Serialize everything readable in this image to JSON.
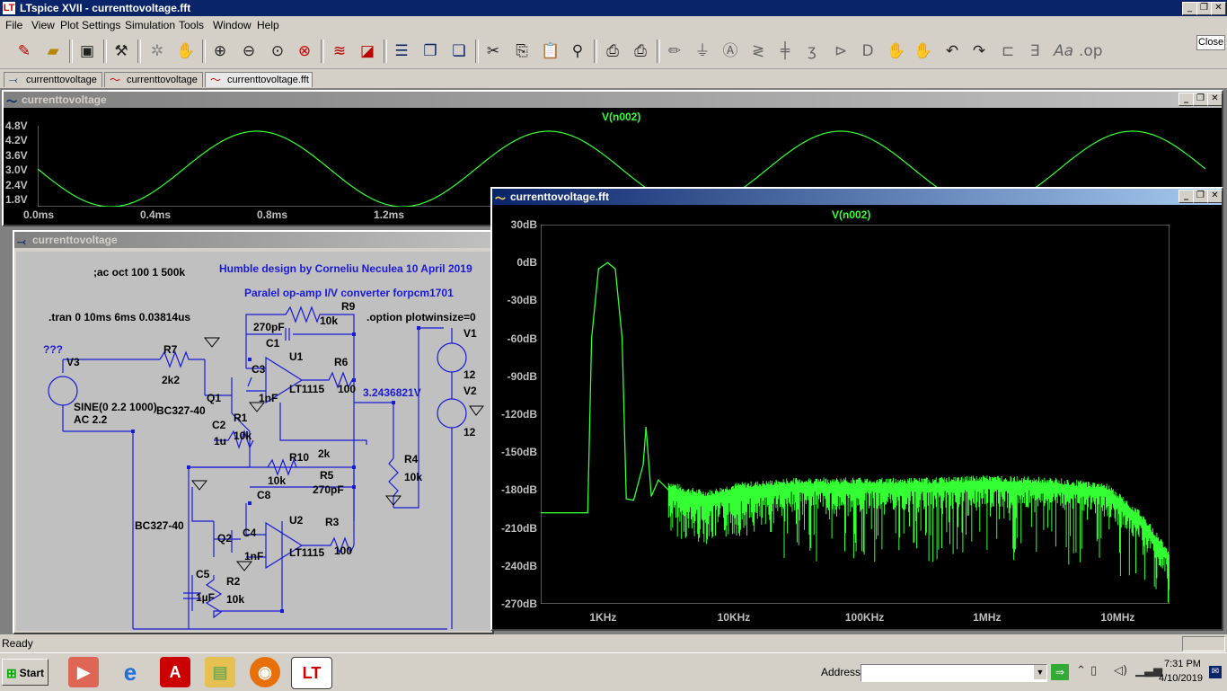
{
  "app": {
    "title": "LTspice XVII - currenttovoltage.fft",
    "icon": "ltspice-icon"
  },
  "window_buttons": [
    "_",
    "❐",
    "✕"
  ],
  "menu": [
    "File",
    "View",
    "Plot Settings",
    "Simulation",
    "Tools",
    "Window",
    "Help"
  ],
  "toolbar": {
    "icons": [
      "new-schematic-icon",
      "open-icon",
      "save-icon",
      "control-panel-icon",
      "run-icon",
      "halt-icon",
      "zoom-in-icon",
      "zoom-out-icon",
      "zoom-fit-icon",
      "zoom-cancel-icon",
      "autorange-icon",
      "pick-visible-icon",
      "tile-horizontal-icon",
      "tile-vertical-icon",
      "cascade-icon",
      "cut-icon",
      "copy-icon",
      "paste-icon",
      "find-icon",
      "print-icon",
      "print-setup-icon",
      "draw-wire-icon",
      "ground-icon",
      "label-net-icon",
      "resistor-icon",
      "capacitor-icon",
      "inductor-icon",
      "diode-icon",
      "component-icon",
      "move-icon",
      "drag-icon",
      "undo-icon",
      "redo-icon",
      "rotate-icon",
      "mirror-icon",
      "text-icon",
      "spice-directive-icon"
    ],
    "close_label": "Close"
  },
  "tabs": [
    {
      "label": "currenttovoltage",
      "icon": "schematic-icon"
    },
    {
      "label": "currenttovoltage",
      "icon": "waveform-icon"
    },
    {
      "label": "currenttovoltage.fft",
      "icon": "waveform-icon"
    }
  ],
  "time_plot": {
    "title": "currenttovoltage",
    "trace": "V(n002)",
    "trace_color": "#33ff33",
    "y_ticks": [
      "4.8V",
      "4.2V",
      "3.6V",
      "3.0V",
      "2.4V",
      "1.8V"
    ],
    "x_ticks": [
      "0.0ms",
      "0.4ms",
      "0.8ms",
      "1.2ms"
    ]
  },
  "schematic": {
    "title": "currenttovoltage",
    "directives": [
      ";ac oct 100 1 500k",
      ".tran 0 10ms 6ms 0.03814us",
      ".option plotwinsize=0"
    ],
    "comments": [
      "Humble design by Corneliu Neculea 10 April 2019",
      "Paralel op-amp I/V converter  forpcm1701"
    ],
    "labels": [
      "???",
      "V3",
      "R7",
      "2k2",
      "SINE(0 2.2 1000)",
      "AC 2.2",
      "Q1",
      "BC327-40",
      "C2",
      "1u",
      "R1",
      "10k",
      "R9",
      "10k",
      "270pF",
      "C1",
      "C3",
      "1nF",
      "U1",
      "LT1115",
      "R6",
      "100",
      "3.2436821V",
      "V1",
      "12",
      "V2",
      "12",
      "R10",
      "2k",
      "10k",
      "R5",
      "270pF",
      "C8",
      "R4",
      "10k",
      "BC327-40",
      "Q2",
      "C4",
      "1nF",
      "U2",
      "LT1115",
      "R3",
      "100",
      "C5",
      "1µF",
      "R2",
      "10k"
    ]
  },
  "fft_plot": {
    "title": "currenttovoltage.fft",
    "trace": "V(n002)",
    "trace_color": "#33ff33",
    "y_ticks": [
      "30dB",
      "0dB",
      "-30dB",
      "-60dB",
      "-90dB",
      "-120dB",
      "-150dB",
      "-180dB",
      "-210dB",
      "-240dB",
      "-270dB"
    ],
    "x_ticks": [
      "1KHz",
      "10KHz",
      "100KHz",
      "1MHz",
      "10MHz"
    ]
  },
  "chart_data": [
    {
      "type": "line",
      "title": "V(n002)",
      "xlabel": "",
      "ylabel": "",
      "x_unit": "ms",
      "xlim": [
        0,
        2.1
      ],
      "ylim": [
        1.8,
        4.8
      ],
      "grid": false,
      "series": [
        {
          "name": "V(n002)",
          "note_amplitude": 1.4,
          "offset": 3.2,
          "frequency_hz": 1000,
          "x": [
            0,
            0.125,
            0.25,
            0.375,
            0.5,
            0.625,
            0.75,
            0.875,
            1.0,
            1.125,
            1.25,
            1.375,
            1.5,
            1.625,
            1.75,
            1.875,
            2.0
          ],
          "values": [
            3.2,
            2.2,
            1.8,
            2.2,
            3.2,
            4.2,
            4.6,
            4.2,
            3.2,
            2.2,
            1.8,
            2.2,
            3.2,
            4.2,
            4.6,
            4.2,
            3.2
          ]
        }
      ]
    },
    {
      "type": "line",
      "title": "V(n002)",
      "xlabel": "",
      "ylabel": "",
      "x_scale": "log",
      "xlim": [
        300,
        25000000
      ],
      "ylim": [
        -270,
        30
      ],
      "grid": false,
      "series": [
        {
          "name": "V(n002)",
          "x": [
            300,
            700,
            750,
            850,
            1000,
            1150,
            1300,
            1400,
            1600,
            1900,
            2000,
            2200,
            2500,
            3000,
            4000,
            6000,
            10000,
            30000,
            100000,
            300000,
            1000000,
            3000000,
            8000000,
            15000000,
            25000000
          ],
          "values": [
            -198,
            -198,
            -60,
            -5,
            0,
            -5,
            -60,
            -187,
            -188,
            -160,
            -130,
            -185,
            -172,
            -180,
            -185,
            -188,
            -182,
            -178,
            -178,
            -178,
            -176,
            -178,
            -182,
            -205,
            -235
          ]
        }
      ]
    }
  ],
  "status": {
    "text": "Ready"
  },
  "taskbar": {
    "start_label": "Start",
    "apps": [
      "media-player-icon",
      "internet-explorer-icon",
      "acrobat-icon",
      "file-explorer-icon",
      "firefox-icon",
      "ltspice-icon"
    ],
    "address_label": "Address",
    "address_value": "",
    "time": "7:31 PM",
    "date": "4/10/2019"
  }
}
